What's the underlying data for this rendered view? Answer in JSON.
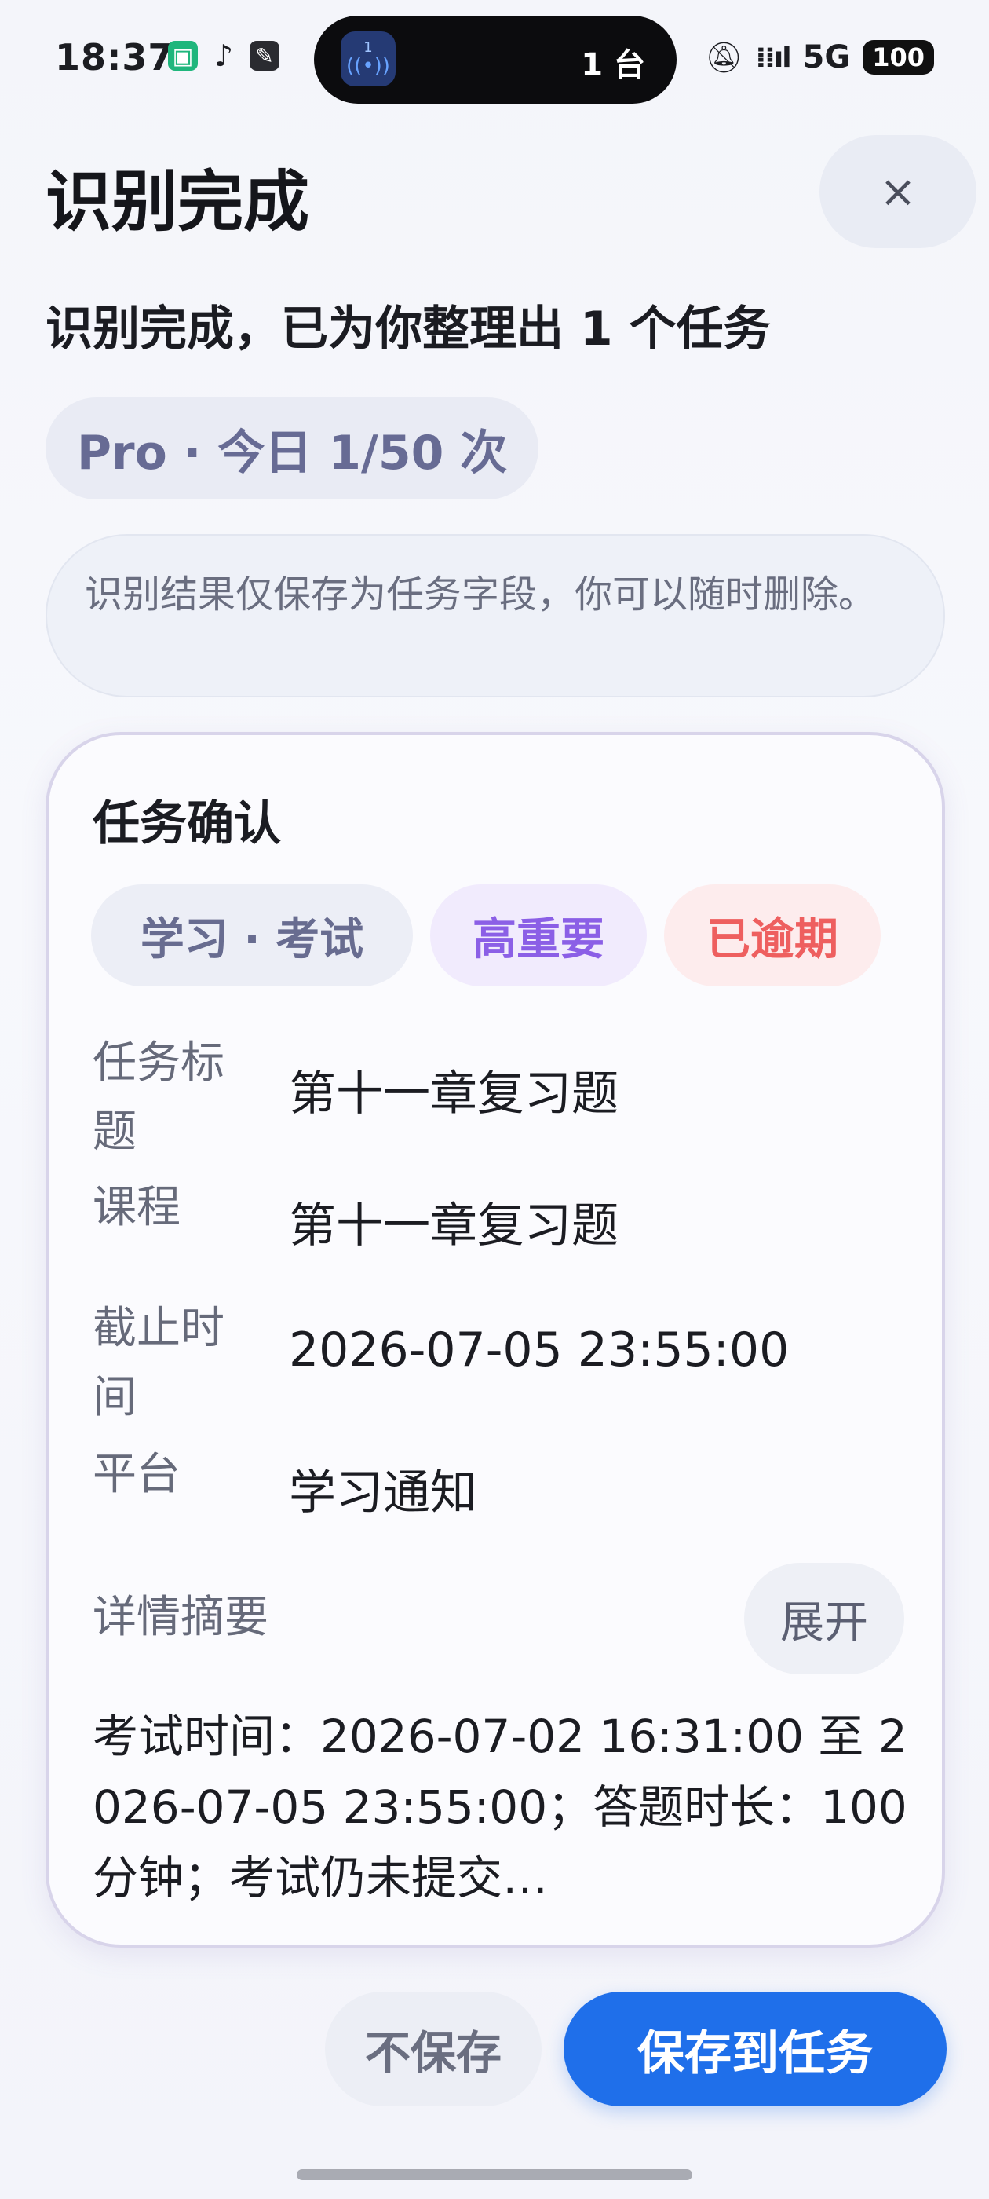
{
  "status_bar": {
    "time": "18:37",
    "island_badge": "1",
    "island_text": "1 台",
    "network": "5G",
    "battery": "100",
    "app_icons": [
      "wechat-pay-icon",
      "tiktok-icon",
      "notes-app-icon"
    ]
  },
  "header": {
    "title": "识别完成",
    "close_label": "×"
  },
  "subtitle": "识别完成，已为你整理出 1 个任务",
  "quota_badge": "Pro · 今日 1/50 次",
  "notice": "识别结果仅保存为任务字段，你可以随时删除。",
  "card": {
    "title": "任务确认",
    "tags": {
      "category": "学习 · 考试",
      "importance": "高重要",
      "status": "已逾期"
    },
    "fields": {
      "title_label": "任务标题",
      "title_value": "第十一章复习题",
      "course_label": "课程",
      "course_value": "第十一章复习题",
      "deadline_label": "截止时间",
      "deadline_value": "2026-07-05 23:55:00",
      "platform_label": "平台",
      "platform_value": "学习通知"
    },
    "summary_label": "详情摘要",
    "expand_label": "展开",
    "summary_text": "考试时间：2026-07-02 16:31:00 至 2026-07-05 23:55:00；答题时长：100分钟；考试仍未提交…"
  },
  "actions": {
    "discard_label": "不保存",
    "save_label": "保存到任务"
  },
  "colors": {
    "primary": "#1f6fea",
    "importance": "#8b5fe6",
    "overdue": "#ee5f5f"
  }
}
